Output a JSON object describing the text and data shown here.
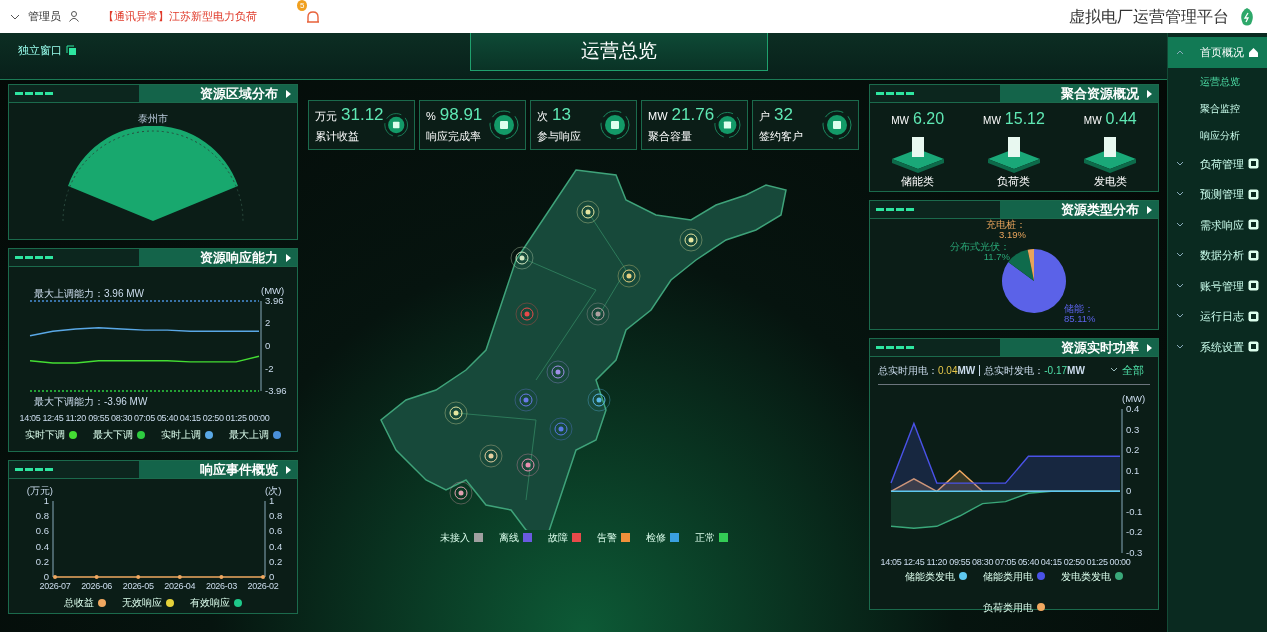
{
  "top_bar": {
    "user": "管理员",
    "alert": "【通讯异常】江苏新型电力负荷",
    "bell_badge": "5",
    "title": "虚拟电厂运营管理平台"
  },
  "header": {
    "popout": "独立窗口",
    "title": "运营总览"
  },
  "region_panel": {
    "title": "资源区域分布",
    "region": "泰州市"
  },
  "response_panel": {
    "title": "资源响应能力",
    "max_up": "最大上调能力：3.96 MW",
    "max_down": "最大下调能力：-3.96 MW",
    "chart_data": {
      "type": "line",
      "ylabel": "(MW)",
      "categories": [
        "14:05",
        "12:45",
        "11:20",
        "09:55",
        "08:30",
        "07:05",
        "05:40",
        "04:15",
        "02:50",
        "01:25",
        "00:00"
      ],
      "yticks": [
        {
          "value": -3.96,
          "label": "-3.96"
        },
        -2,
        0,
        2,
        {
          "value": 3.96,
          "label": "3.96"
        }
      ],
      "ylim": [
        -3.96,
        3.96
      ],
      "series": [
        {
          "name": "最大上调",
          "color": "#4a90d9",
          "line_style": "dashed",
          "values": [
            3.96,
            3.96,
            3.96,
            3.96,
            3.96,
            3.96,
            3.96,
            3.96,
            3.96,
            3.96,
            3.96
          ]
        },
        {
          "name": "实时上调",
          "color": "#5aa8e6",
          "values": [
            0.9,
            1.3,
            1.5,
            1.6,
            1.5,
            1.4,
            1.4,
            1.3,
            1.3,
            1.3,
            1.3
          ]
        },
        {
          "name": "最大下调",
          "color": "#2ecc40",
          "line_style": "dashed",
          "values": [
            -3.96,
            -3.96,
            -3.96,
            -3.96,
            -3.96,
            -3.96,
            -3.96,
            -3.96,
            -3.96,
            -3.96,
            -3.96
          ]
        },
        {
          "name": "实时下调",
          "color": "#44dd33",
          "values": [
            -1.3,
            -1.5,
            -1.5,
            -1.3,
            -1.3,
            -1.3,
            -1.3,
            -1.4,
            -1.4,
            -1.4,
            -0.9
          ]
        }
      ]
    }
  },
  "events_panel": {
    "title": "响应事件概览",
    "chart_data": {
      "type": "line",
      "ylabel": "(万元)",
      "categories": [
        "2026-07",
        "2026-06",
        "2026-05",
        "2026-04",
        "2026-03",
        "2026-02"
      ],
      "yticks": [
        0,
        0.2,
        0.4,
        0.6,
        0.8,
        1
      ],
      "ylim": [
        0,
        1
      ],
      "series": [
        {
          "name": "有效响应",
          "color": "#1ec98a",
          "values": [
            null,
            null,
            null,
            null,
            null,
            null
          ]
        },
        {
          "name": "无效响应",
          "color": "#e6d23a",
          "values": [
            null,
            null,
            null,
            null,
            null,
            null
          ]
        },
        {
          "name": "总收益",
          "color": "#f0a860",
          "values": [
            0,
            0,
            0,
            0,
            0,
            0
          ]
        }
      ]
    },
    "secondary_axis": {
      "label": "(次)",
      "ticks": [
        "1",
        "0.8",
        "0.6",
        "0.4",
        "0.2",
        "0"
      ]
    }
  },
  "stats": [
    {
      "value": "31.12",
      "unit": "万元",
      "label": "累计收益"
    },
    {
      "value": "98.91",
      "unit": "%",
      "label": "响应完成率"
    },
    {
      "value": "13",
      "unit": "次",
      "label": "参与响应"
    },
    {
      "value": "21.76",
      "unit": "MW",
      "label": "聚合容量"
    },
    {
      "value": "32",
      "unit": "户",
      "label": "签约客户"
    }
  ],
  "map": {
    "legend": [
      {
        "label": "未接入",
        "color": "#a0a0a0"
      },
      {
        "label": "离线",
        "color": "#6a5ae0"
      },
      {
        "label": "故障",
        "color": "#e84a4a"
      },
      {
        "label": "告警",
        "color": "#f0903a"
      },
      {
        "label": "检修",
        "color": "#3aa0e0"
      },
      {
        "label": "正常",
        "color": "#33cc55"
      }
    ]
  },
  "aggregate_panel": {
    "title": "聚合资源概况",
    "items": [
      {
        "value": "6.20",
        "unit": "MW",
        "label": "储能类"
      },
      {
        "value": "15.12",
        "unit": "MW",
        "label": "负荷类"
      },
      {
        "value": "0.44",
        "unit": "MW",
        "label": "发电类"
      }
    ]
  },
  "types_panel": {
    "title": "资源类型分布",
    "label_suffix": "：",
    "chart_data": {
      "type": "pie",
      "categories": [
        "储能",
        "分布式光伏",
        "充电桩"
      ],
      "values": [
        85.11,
        11.7,
        3.19
      ],
      "colors": [
        "#5b62e8",
        "#0f6b4c",
        "#e8a45c"
      ],
      "value_labels": [
        "85.11%",
        "11.7%",
        "3.19%"
      ]
    }
  },
  "power_panel": {
    "title": "资源实时功率",
    "filter": "全部",
    "summary": [
      {
        "label": "总实时用电：",
        "value": "0.04",
        "unit": "MW"
      },
      {
        "label": "总实时发电：",
        "value": "-0.17",
        "unit": "MW"
      }
    ],
    "chart_data": {
      "type": "area",
      "ylabel": "(MW)",
      "categories": [
        "14:05",
        "12:45",
        "11:20",
        "09:55",
        "08:30",
        "07:05",
        "05:40",
        "04:15",
        "02:50",
        "01:25",
        "00:00"
      ],
      "yticks": [
        -0.3,
        -0.2,
        -0.1,
        0,
        0.1,
        0.2,
        0.3,
        0.4
      ],
      "ylim": [
        -0.3,
        0.4
      ],
      "series": [
        {
          "name": "负荷类用电",
          "color": "#f0a860",
          "values": [
            0,
            0.06,
            0,
            0.1,
            0,
            0,
            0,
            0,
            0,
            0,
            0
          ]
        },
        {
          "name": "发电类发电",
          "color": "#3aa87a",
          "values": [
            -0.17,
            -0.18,
            -0.17,
            -0.12,
            -0.06,
            -0.05,
            -0.01,
            0,
            0,
            0,
            0
          ]
        },
        {
          "name": "储能类用电",
          "color": "#4a52e8",
          "values": [
            0.04,
            0.33,
            0.04,
            0.04,
            0.04,
            0.04,
            0.17,
            0.17,
            0.17,
            0.17,
            0.17
          ]
        },
        {
          "name": "储能类发电",
          "color": "#5ec8f0",
          "values": [
            0,
            0,
            0,
            0,
            0,
            0,
            0,
            0,
            0,
            0,
            0
          ]
        }
      ]
    }
  },
  "sidebar": {
    "items": [
      {
        "label": "首页概况",
        "selected": true,
        "expanded": true,
        "children": [
          {
            "label": "运营总览",
            "selected": true
          },
          {
            "label": "聚合监控",
            "selected": false
          },
          {
            "label": "响应分析",
            "selected": false
          }
        ]
      },
      {
        "label": "负荷管理",
        "selected": false,
        "expanded": false
      },
      {
        "label": "预测管理",
        "selected": false,
        "expanded": false
      },
      {
        "label": "需求响应",
        "selected": false,
        "expanded": false
      },
      {
        "label": "数据分析",
        "selected": false,
        "expanded": false
      },
      {
        "label": "账号管理",
        "selected": false,
        "expanded": false
      },
      {
        "label": "运行日志",
        "selected": false,
        "expanded": false
      },
      {
        "label": "系统设置",
        "selected": false,
        "expanded": false
      }
    ]
  }
}
